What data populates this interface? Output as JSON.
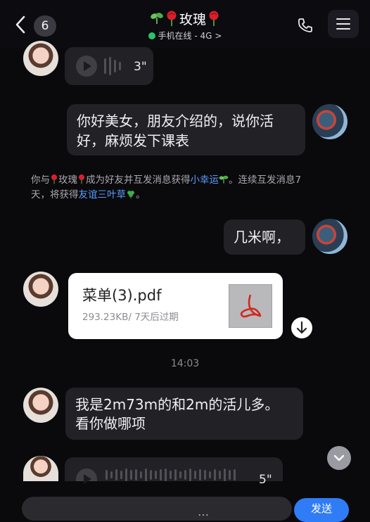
{
  "header": {
    "unread_count": "6",
    "title_name": "玫瑰",
    "status_text": "手机在线 - 4G",
    "status_chevron": ">"
  },
  "messages": [
    {
      "type": "voice",
      "side": "left",
      "duration": "3\""
    },
    {
      "type": "text",
      "side": "right",
      "lines": [
        "你好美女，朋友介绍的，说你活",
        "好，麻烦发下课表"
      ]
    },
    {
      "type": "notice",
      "parts": {
        "p1": "你与",
        "name": "玫瑰",
        "p2": "成为好友并互发消息获得",
        "link1": "小幸运",
        "p3": "。连续互发消息7",
        "p4": "天，将获得",
        "link2": "友谊三叶草",
        "p5": "。"
      }
    },
    {
      "type": "text",
      "side": "right",
      "lines": [
        "几米啊，"
      ]
    },
    {
      "type": "file",
      "side": "left",
      "file_name": "菜单(3).pdf",
      "file_meta": "293.23KB/ 7天后过期"
    },
    {
      "type": "timestamp",
      "text": "14:03"
    },
    {
      "type": "text",
      "side": "left",
      "lines": [
        "我是2m73m的和2m的活儿多。",
        "看你做哪项"
      ]
    },
    {
      "type": "voice",
      "side": "left",
      "duration": "5\""
    }
  ],
  "input": {
    "partial_text": "…"
  },
  "send_label": "发送",
  "colors": {
    "accent": "#2f7cf6",
    "link": "#5b9bff",
    "online": "#29c46a",
    "bubble": "#222226"
  }
}
